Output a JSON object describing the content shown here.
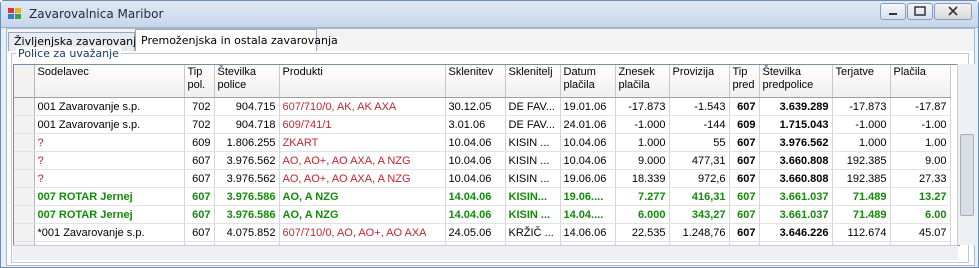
{
  "window": {
    "title": "Zavarovalnica Maribor"
  },
  "tabs": [
    {
      "label": "Življenjska zavarovanja",
      "active": false
    },
    {
      "label": "Premoženjska in ostala zavarovanja",
      "active": true
    }
  ],
  "group": {
    "label": "Police za uvažanje"
  },
  "columns": [
    "Sodelavec",
    "Tip pol.",
    "Številka police",
    "Produkti",
    "Sklenitev",
    "Sklenitelj",
    "Datum plačila",
    "Znesek plačila",
    "Provizija",
    "Tip pred",
    "Številka predpolice",
    "Terjatve",
    "Plačila"
  ],
  "rows": [
    {
      "style": "normal",
      "prod_red": true,
      "cells": [
        "001 Zavarovanje s.p.",
        "702",
        "904.715",
        "607/710/0, AK, AK AXA",
        "30.12.05",
        "DE FAV...",
        "19.01.06",
        "-17.873",
        "-1.543",
        "607",
        "3.639.289",
        "-17.873",
        "-17.87"
      ]
    },
    {
      "style": "normal",
      "prod_red": true,
      "cells": [
        "001 Zavarovanje s.p.",
        "702",
        "904.718",
        "609/741/1",
        "3.01.06",
        "DE FAV...",
        "24.01.06",
        "-1.000",
        "-144",
        "609",
        "1.715.043",
        "-1.000",
        "-1.00"
      ]
    },
    {
      "style": "red",
      "prod_red": false,
      "cells": [
        "?",
        "609",
        "1.806.255",
        "ZKART",
        "10.04.06",
        "KISIN ...",
        "10.04.06",
        "1.000",
        "55",
        "607",
        "3.976.562",
        "1.000",
        "1.00"
      ]
    },
    {
      "style": "red",
      "prod_red": false,
      "cells": [
        "?",
        "607",
        "3.976.562",
        "AO, AO+, AO AXA, A NZG",
        "10.04.06",
        "KISIN ...",
        "10.04.06",
        "9.000",
        "477,31",
        "607",
        "3.660.808",
        "192.385",
        "9.00"
      ]
    },
    {
      "style": "red",
      "prod_red": false,
      "cells": [
        "?",
        "607",
        "3.976.562",
        "AO, AO+, AO AXA, A NZG",
        "10.04.06",
        "KISIN ...",
        "19.06.06",
        "18.339",
        "972,6",
        "607",
        "3.660.808",
        "192.385",
        "27.33"
      ]
    },
    {
      "style": "green",
      "prod_red": false,
      "cells": [
        "007 ROTAR Jernej",
        "607",
        "3.976.586",
        "AO, A NZG",
        "14.04.06",
        "KISIN...",
        "19.06....",
        "7.277",
        "416,31",
        "607",
        "3.661.037",
        "71.489",
        "13.27"
      ]
    },
    {
      "style": "green",
      "prod_red": false,
      "cells": [
        "007 ROTAR Jernej",
        "607",
        "3.976.586",
        "AO, A NZG",
        "14.04.06",
        "KISIN ...",
        "14.04....",
        "6.000",
        "343,27",
        "607",
        "3.661.037",
        "71.489",
        "6.00"
      ]
    },
    {
      "style": "normal",
      "prod_red": true,
      "cells": [
        "*001 Zavarovanje s.p.",
        "607",
        "4.075.852",
        "607/710/0, AO, AO+, AO AXA",
        "24.05.06",
        "KRŽIČ ...",
        "14.06.06",
        "22.535",
        "1.248,76",
        "607",
        "3.646.226",
        "112.674",
        "45.07"
      ]
    }
  ]
}
